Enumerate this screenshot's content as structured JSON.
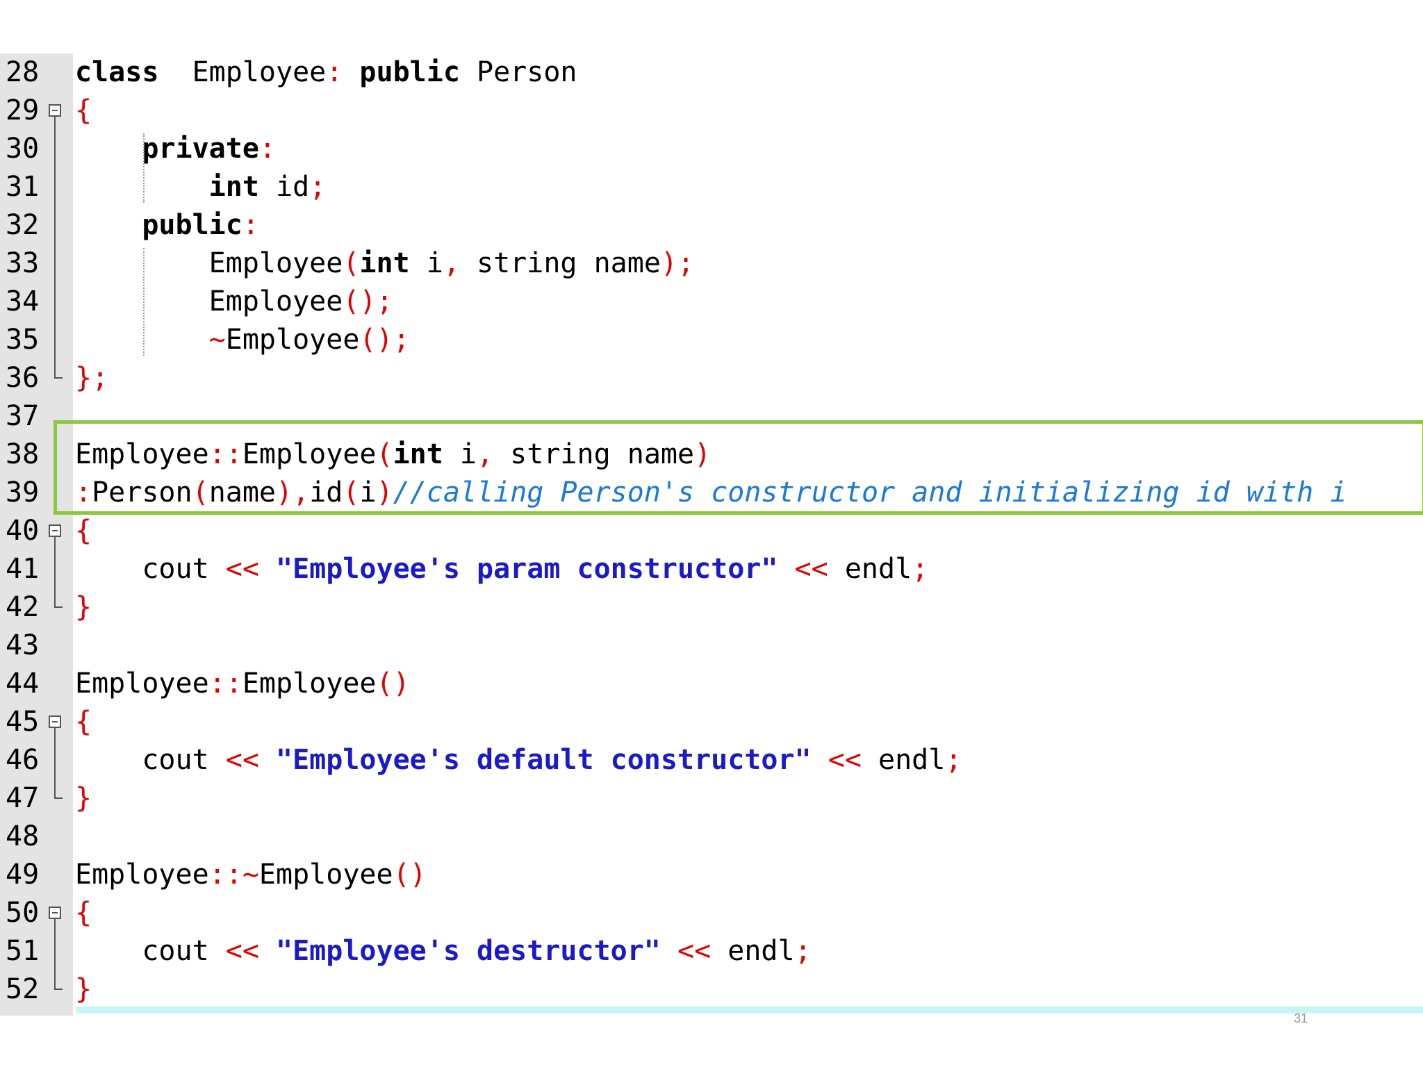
{
  "editor": {
    "lines": [
      {
        "n": "28",
        "tokens": [
          [
            "kw",
            "class"
          ],
          [
            "",
            "  Employee"
          ],
          [
            "op",
            ":"
          ],
          [
            "",
            ""
          ],
          [
            "kw",
            " public"
          ],
          [
            "",
            " Person"
          ]
        ]
      },
      {
        "n": "29",
        "tokens": [
          [
            "pn",
            "{"
          ]
        ]
      },
      {
        "n": "30",
        "tokens": [
          [
            "",
            "    "
          ],
          [
            "kw",
            "private"
          ],
          [
            "op",
            ":"
          ]
        ]
      },
      {
        "n": "31",
        "tokens": [
          [
            "",
            "        "
          ],
          [
            "kw",
            "int"
          ],
          [
            "",
            " id"
          ],
          [
            "pn",
            ";"
          ]
        ]
      },
      {
        "n": "32",
        "tokens": [
          [
            "",
            "    "
          ],
          [
            "kw",
            "public"
          ],
          [
            "op",
            ":"
          ]
        ]
      },
      {
        "n": "33",
        "tokens": [
          [
            "",
            "        Employee"
          ],
          [
            "pn",
            "("
          ],
          [
            "kw",
            "int"
          ],
          [
            "",
            " i"
          ],
          [
            "pn",
            ","
          ],
          [
            "",
            " string name"
          ],
          [
            "pn",
            ");"
          ]
        ]
      },
      {
        "n": "34",
        "tokens": [
          [
            "",
            "        Employee"
          ],
          [
            "pn",
            "();"
          ]
        ]
      },
      {
        "n": "35",
        "tokens": [
          [
            "",
            "        "
          ],
          [
            "pn",
            "~"
          ],
          [
            "",
            "Employee"
          ],
          [
            "pn",
            "();"
          ]
        ]
      },
      {
        "n": "36",
        "tokens": [
          [
            "pn",
            "};"
          ]
        ]
      },
      {
        "n": "37",
        "tokens": []
      },
      {
        "n": "38",
        "tokens": [
          [
            "",
            "Employee"
          ],
          [
            "op",
            "::"
          ],
          [
            "",
            "Employee"
          ],
          [
            "pn",
            "("
          ],
          [
            "kw",
            "int"
          ],
          [
            "",
            " i"
          ],
          [
            "pn",
            ","
          ],
          [
            "",
            " string name"
          ],
          [
            "pn",
            ")"
          ]
        ]
      },
      {
        "n": "39",
        "tokens": [
          [
            "op",
            ":"
          ],
          [
            "",
            "Person"
          ],
          [
            "pn",
            "("
          ],
          [
            "",
            "name"
          ],
          [
            "pn",
            "),"
          ],
          [
            "",
            "id"
          ],
          [
            "pn",
            "("
          ],
          [
            "",
            "i"
          ],
          [
            "pn",
            ")"
          ],
          [
            "cm",
            "//calling Person's constructor and initializing id with i"
          ]
        ]
      },
      {
        "n": "40",
        "tokens": [
          [
            "pn",
            "{"
          ]
        ]
      },
      {
        "n": "41",
        "tokens": [
          [
            "",
            "    cout "
          ],
          [
            "op",
            "<<"
          ],
          [
            "str",
            " \"Employee's param constructor\""
          ],
          [
            "",
            " "
          ],
          [
            "op",
            "<<"
          ],
          [
            "",
            " endl"
          ],
          [
            "pn",
            ";"
          ]
        ]
      },
      {
        "n": "42",
        "tokens": [
          [
            "pn",
            "}"
          ]
        ]
      },
      {
        "n": "43",
        "tokens": []
      },
      {
        "n": "44",
        "tokens": [
          [
            "",
            "Employee"
          ],
          [
            "op",
            "::"
          ],
          [
            "",
            "Employee"
          ],
          [
            "pn",
            "()"
          ]
        ]
      },
      {
        "n": "45",
        "tokens": [
          [
            "pn",
            "{"
          ]
        ]
      },
      {
        "n": "46",
        "tokens": [
          [
            "",
            "    cout "
          ],
          [
            "op",
            "<<"
          ],
          [
            "str",
            " \"Employee's default constructor\""
          ],
          [
            "",
            " "
          ],
          [
            "op",
            "<<"
          ],
          [
            "",
            " endl"
          ],
          [
            "pn",
            ";"
          ]
        ]
      },
      {
        "n": "47",
        "tokens": [
          [
            "pn",
            "}"
          ]
        ]
      },
      {
        "n": "48",
        "tokens": []
      },
      {
        "n": "49",
        "tokens": [
          [
            "",
            "Employee"
          ],
          [
            "op",
            "::"
          ],
          [
            "pn",
            "~"
          ],
          [
            "",
            "Employee"
          ],
          [
            "pn",
            "()"
          ]
        ]
      },
      {
        "n": "50",
        "tokens": [
          [
            "pn",
            "{"
          ]
        ]
      },
      {
        "n": "51",
        "tokens": [
          [
            "",
            "    cout "
          ],
          [
            "op",
            "<<"
          ],
          [
            "str",
            " \"Employee's destructor\""
          ],
          [
            "",
            " "
          ],
          [
            "op",
            "<<"
          ],
          [
            "",
            " endl"
          ],
          [
            "pn",
            ";"
          ]
        ]
      },
      {
        "n": "52",
        "tokens": [
          [
            "pn",
            "}"
          ]
        ]
      }
    ]
  },
  "slide": {
    "page_number": "31"
  },
  "colors": {
    "keyword": "#000000",
    "punctuation": "#e00000",
    "string": "#1a1acc",
    "comment": "#1a7ad6",
    "highlight_border": "#8dc63f",
    "gutter": "#e4e4e4"
  }
}
